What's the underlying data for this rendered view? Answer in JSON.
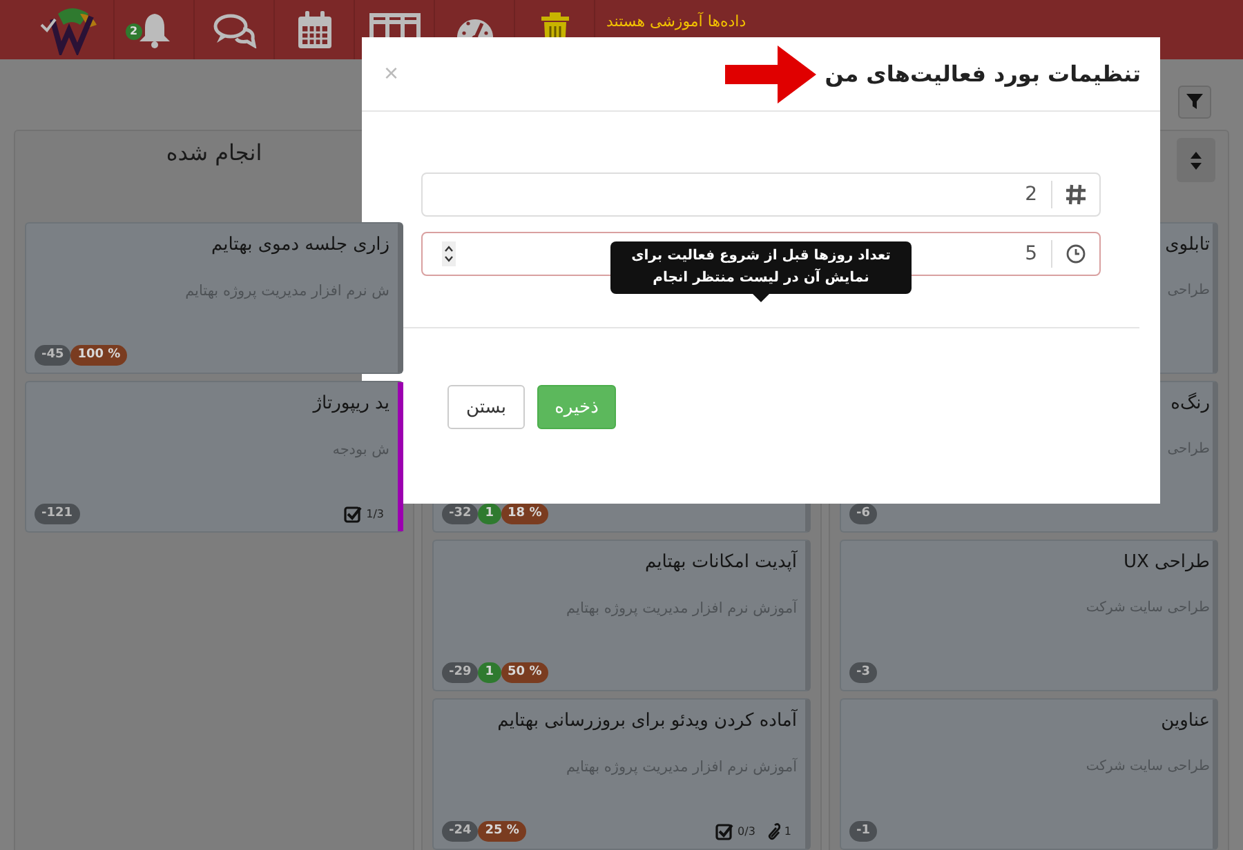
{
  "header": {
    "notice": "داده‌ها آموزشی هستند",
    "bell_badge": "2"
  },
  "columns": [
    {
      "sort_button": true,
      "cards": [
        {
          "title": "تابلوی",
          "subtitle": "طراحی"
        },
        {
          "title": "رنگ‌ه",
          "subtitle": "طراحی",
          "badges": [
            {
              "text": "-6",
              "kind": "days"
            }
          ]
        },
        {
          "title": "طراحی UX",
          "subtitle": "طراحی سایت شرکت",
          "badges": [
            {
              "text": "-3",
              "kind": "days"
            }
          ]
        },
        {
          "title": "عناوین",
          "subtitle": "طراحی سایت شرکت",
          "badges": [
            {
              "text": "-1",
              "kind": "days"
            }
          ]
        }
      ]
    },
    {
      "cards": [
        {
          "badges": [
            {
              "text": "18 %",
              "kind": "percent"
            },
            {
              "text": "1",
              "kind": "count"
            },
            {
              "text": "-32",
              "kind": "days"
            }
          ]
        },
        {
          "title": "آپدیت امکانات بهتایم",
          "subtitle": "آموزش نرم افزار مدیریت پروژه بهتایم",
          "badges": [
            {
              "text": "50 %",
              "kind": "percent"
            },
            {
              "text": "1",
              "kind": "count"
            },
            {
              "text": "-29",
              "kind": "days"
            }
          ]
        },
        {
          "title": "آماده کردن ویدئو برای بروزرسانی بهتایم",
          "subtitle": "آموزش نرم افزار مدیریت پروژه بهتایم",
          "badges": [
            {
              "text": "25 %",
              "kind": "percent"
            },
            {
              "text": "-24",
              "kind": "days"
            }
          ],
          "checklist": "0/3",
          "attachments": "1"
        }
      ]
    },
    {
      "title": "انجام شده",
      "cards": [
        {
          "title": "زاری جلسه دموی بهتایم",
          "subtitle": "ش نرم افزار مدیریت پروژه بهتایم",
          "badges": [
            {
              "text": "100 %",
              "kind": "percent"
            },
            {
              "text": "-45",
              "kind": "days"
            }
          ]
        },
        {
          "title": "ید ریپورتاژ",
          "subtitle": "ش بودجه",
          "badges": [
            {
              "text": "-121",
              "kind": "days"
            }
          ],
          "checklist": "1/3",
          "color": "#9c00b0"
        }
      ]
    }
  ],
  "modal": {
    "title": "تنظیمات بورد فعالیت‌های من",
    "close": "×",
    "fields": [
      {
        "kind": "count",
        "value": "2",
        "invalid": false
      },
      {
        "kind": "time",
        "value": "5",
        "invalid": true,
        "spinner": true
      }
    ],
    "tooltip": "تعداد روزها قبل از شروع فعالیت برای نمایش آن در لیست منتظر انجام",
    "buttons": [
      {
        "label": "ذخیره",
        "kind": "primary"
      },
      {
        "label": "بستن",
        "kind": "default"
      }
    ]
  }
}
